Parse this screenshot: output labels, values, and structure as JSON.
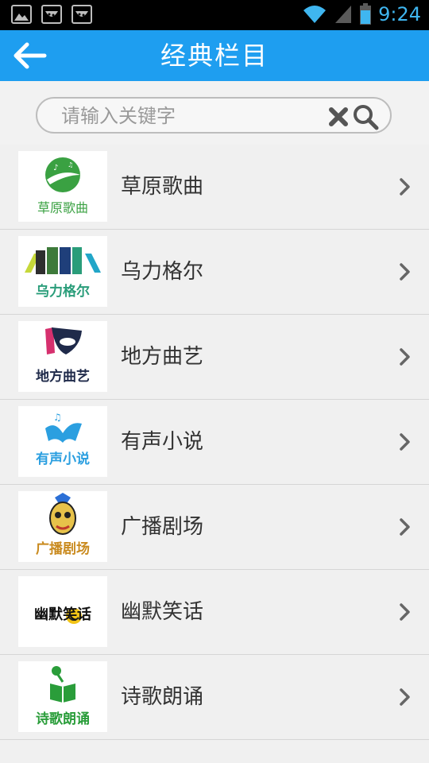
{
  "status_bar": {
    "time": "9:24",
    "icons": [
      "image-icon",
      "notification-icon",
      "notification-icon",
      "wifi-icon",
      "signal-icon",
      "battery-icon"
    ]
  },
  "header": {
    "title": "经典栏目",
    "back_icon": "back-arrow-icon",
    "color": "#1e9ef0"
  },
  "search": {
    "placeholder": "请输入关键字",
    "value": "",
    "clear_icon": "close-icon",
    "search_icon": "search-icon"
  },
  "list": {
    "items": [
      {
        "label": "草原歌曲",
        "logo_text": "草原歌曲",
        "color": "#3aa142"
      },
      {
        "label": "乌力格尔",
        "logo_text": "乌力格尔",
        "color": "#2a9d7a"
      },
      {
        "label": "地方曲艺",
        "logo_text": "地方曲艺",
        "color": "#1f2a4a"
      },
      {
        "label": "有声小说",
        "logo_text": "有声小说",
        "color": "#2b9fe0"
      },
      {
        "label": "广播剧场",
        "logo_text": "广播剧场",
        "color": "#c98a1e"
      },
      {
        "label": "幽默笑话",
        "logo_text": "幽默笑话",
        "color": "#111111"
      },
      {
        "label": "诗歌朗诵",
        "logo_text": "诗歌朗诵",
        "color": "#2a9d3a"
      }
    ]
  }
}
